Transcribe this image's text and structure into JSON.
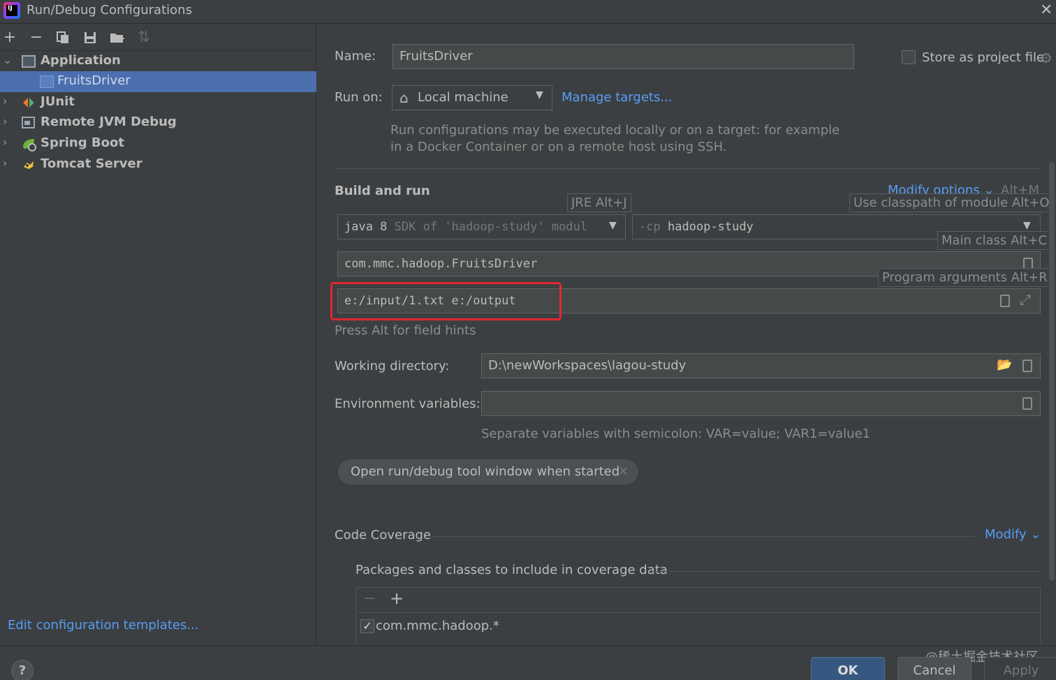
{
  "window": {
    "title": "Run/Debug Configurations",
    "close_glyph": "✕"
  },
  "toolbar": {
    "add": "+",
    "remove": "−",
    "copy": "⧉",
    "save": "💾",
    "folder": "📁",
    "sort": "⇅"
  },
  "tree": {
    "items": [
      {
        "label": "Application",
        "expanded": true,
        "icon": "application-icon"
      },
      {
        "label": "FruitsDriver",
        "selected": true,
        "icon": "application-config-icon"
      },
      {
        "label": "JUnit",
        "expanded": false,
        "icon": "junit-icon"
      },
      {
        "label": "Remote JVM Debug",
        "expanded": false,
        "icon": "remote-debug-icon"
      },
      {
        "label": "Spring Boot",
        "expanded": false,
        "icon": "spring-boot-icon"
      },
      {
        "label": "Tomcat Server",
        "expanded": false,
        "icon": "tomcat-icon"
      }
    ],
    "expanded_glyph": "⌄",
    "collapsed_glyph": "›"
  },
  "edit_templates_link": "Edit configuration templates...",
  "name_field": {
    "label": "Name:",
    "value": "FruitsDriver"
  },
  "store_as_project": {
    "label": "Store as project file",
    "checked": false
  },
  "run_on": {
    "label": "Run on:",
    "value": "Local machine",
    "manage_link": "Manage targets...",
    "hint_line1": "Run configurations may be executed locally or on a target: for example",
    "hint_line2": "in a Docker Container or on a remote host using SSH."
  },
  "build_and_run": {
    "title": "Build and run",
    "modify_options": "Modify options",
    "modify_shortcut": "Alt+M",
    "jre_tooltip": "JRE Alt+J",
    "classpath_tooltip": "Use classpath of module Alt+O",
    "main_class_tooltip": "Main class Alt+C",
    "program_args_tooltip": "Program arguments Alt+R",
    "jre_value_main": "java 8",
    "jre_value_hint": "SDK of 'hadoop-study' modul",
    "cp_prefix": "-cp",
    "cp_value": "hadoop-study",
    "main_class": "com.mmc.hadoop.FruitsDriver",
    "program_args": "e:/input/1.txt e:/output",
    "field_hint": "Press Alt for field hints"
  },
  "working_dir": {
    "label": "Working directory:",
    "value": "D:\\newWorkspaces\\lagou-study"
  },
  "env_vars": {
    "label": "Environment variables:",
    "value": "",
    "hint": "Separate variables with semicolon: VAR=value; VAR1=value1"
  },
  "tag_chip": {
    "label": "Open run/debug tool window when started",
    "close": "×"
  },
  "code_coverage": {
    "title": "Code Coverage",
    "modify": "Modify",
    "packages_title": "Packages and classes to include in coverage data",
    "remove": "−",
    "add": "+",
    "entries": [
      {
        "label": "com.mmc.hadoop.*",
        "checked": true
      }
    ]
  },
  "buttons": {
    "help": "?",
    "ok": "OK",
    "cancel": "Cancel",
    "apply": "Apply"
  },
  "watermark": "@稀土掘金技术社区",
  "colors": {
    "selection": "#4b6eaf",
    "link": "#589df6",
    "highlight_box": "#e0282e",
    "ok_button": "#365880"
  }
}
